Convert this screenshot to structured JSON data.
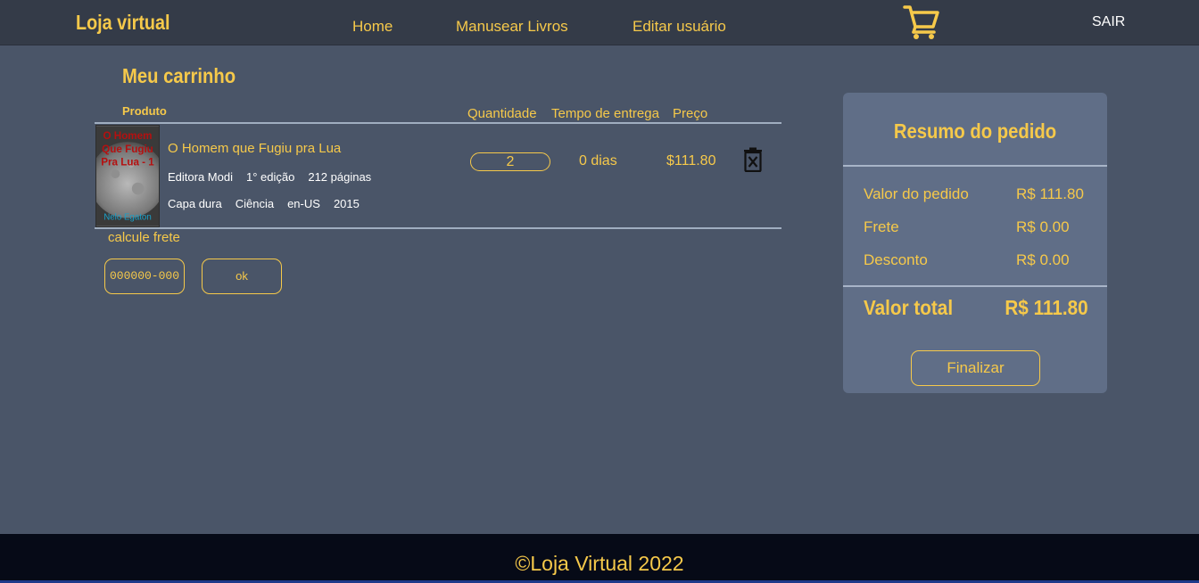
{
  "header": {
    "brand": "Loja virtual",
    "nav": [
      "Home",
      "Manusear Livros",
      "Editar usuário"
    ],
    "logout": "SAIR",
    "cart_icon": "shopping-cart-icon"
  },
  "cart": {
    "title": "Meu carrinho",
    "columns": {
      "product": "Produto",
      "quantity": "Quantidade",
      "delivery": "Tempo de entrega",
      "price": "Preço"
    },
    "items": [
      {
        "name": "O Homem que Fugiu pra Lua",
        "meta1": [
          "Editora Modi",
          "1° edição",
          "212 páginas"
        ],
        "meta2": [
          "Capa dura",
          "Ciência",
          "en-US",
          "2015"
        ],
        "quantity": "2",
        "delivery": "0 dias",
        "price": "$111.80",
        "cover_title": [
          "O Homem",
          "Que Fugiu",
          "Pra Lua - 1"
        ],
        "cover_author": "Nelo Egaton"
      }
    ],
    "shipping": {
      "label": "calcule frete",
      "placeholder": "000000-000",
      "button": "ok"
    }
  },
  "summary": {
    "title": "Resumo do pedido",
    "rows": [
      {
        "label": "Valor do pedido",
        "value": "R$ 111.80"
      },
      {
        "label": "Frete",
        "value": "R$ 0.00"
      },
      {
        "label": "Desconto",
        "value": "R$ 0.00"
      }
    ],
    "total_label": "Valor total",
    "total_value": "R$ 111.80",
    "button": "Finalizar"
  },
  "footer": {
    "text": "©Loja Virtual 2022"
  },
  "colors": {
    "accent": "#f6c94a",
    "background": "#4a5568",
    "header": "#343b48",
    "summary_panel": "#606e87",
    "footer": "#060a17"
  }
}
